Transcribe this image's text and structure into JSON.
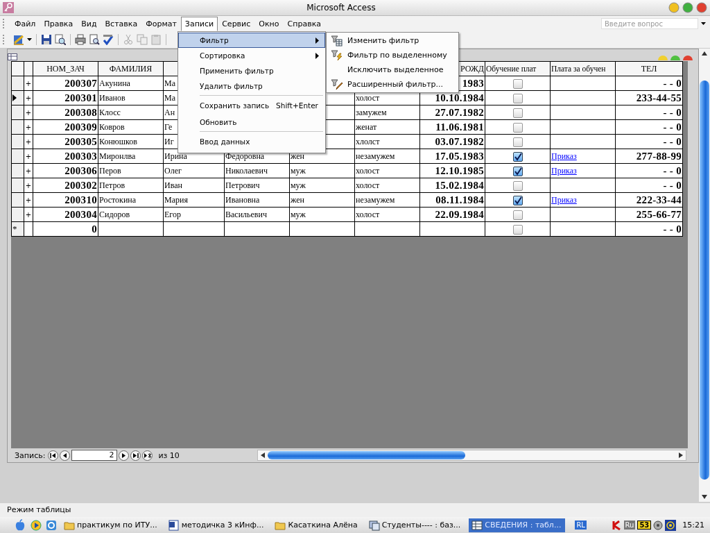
{
  "window": {
    "title": "Microsoft Access"
  },
  "menu_bar": [
    {
      "label": "Файл",
      "selected": false
    },
    {
      "label": "Правка",
      "selected": false
    },
    {
      "label": "Вид",
      "selected": false
    },
    {
      "label": "Вставка",
      "selected": false
    },
    {
      "label": "Формат",
      "selected": false
    },
    {
      "label": "Записи",
      "selected": true
    },
    {
      "label": "Сервис",
      "selected": false
    },
    {
      "label": "Окно",
      "selected": false
    },
    {
      "label": "Справка",
      "selected": false
    }
  ],
  "help_search": {
    "placeholder": "Введите вопрос"
  },
  "menu": [
    {
      "label": "Фильтр",
      "submenu": true,
      "selected": true,
      "separator_before": false
    },
    {
      "label": "Сортировка",
      "submenu": true,
      "selected": false,
      "separator_before": false
    },
    {
      "label": "Применить фильтр",
      "submenu": false,
      "selected": false,
      "separator_before": false
    },
    {
      "label": "Удалить фильтр",
      "submenu": false,
      "selected": false,
      "separator_before": false
    },
    {
      "label": "Сохранить запись",
      "shortcut": "Shift+Enter",
      "submenu": false,
      "selected": false,
      "separator_before": true
    },
    {
      "label": "Обновить",
      "submenu": false,
      "selected": false,
      "separator_before": false
    },
    {
      "label": "Ввод данных",
      "submenu": false,
      "selected": false,
      "separator_before": true
    }
  ],
  "submenu": [
    {
      "label": "Изменить фильтр",
      "kind": "grid"
    },
    {
      "label": "Фильтр по выделенному",
      "kind": "bolt"
    },
    {
      "label": "Исключить выделенное",
      "kind": "plain"
    },
    {
      "label": "Расширенный фильтр...",
      "kind": "pencil"
    }
  ],
  "table": {
    "columns": [
      "НОМ_ЗАЧ",
      "ФАМИЛИЯ",
      null,
      null,
      null,
      null,
      "РОЖД",
      "Обучение плат",
      "Плата за обучен",
      "ТЕЛ"
    ],
    "rows": [
      {
        "current": false,
        "selector": null,
        "expander": "+",
        "cells": [
          "200307",
          "Акунина",
          "Ма",
          null,
          null,
          null,
          "1983"
        ],
        "paid": false,
        "order": null,
        "phone": "- - 0"
      },
      {
        "current": true,
        "selector": null,
        "expander": "+",
        "cells": [
          "200301",
          "Иванов",
          "Ма",
          null,
          null,
          "холост",
          "10.10.1984"
        ],
        "paid": false,
        "order": null,
        "phone": "233-44-55"
      },
      {
        "current": false,
        "selector": null,
        "expander": "+",
        "cells": [
          "200308",
          "Клосс",
          "Ан",
          null,
          null,
          "замужем",
          "27.07.1982"
        ],
        "paid": false,
        "order": null,
        "phone": "- - 0"
      },
      {
        "current": false,
        "selector": null,
        "expander": "+",
        "cells": [
          "200309",
          "Ковров",
          "Ге",
          null,
          null,
          "женат",
          "11.06.1981"
        ],
        "paid": false,
        "order": null,
        "phone": "- - 0"
      },
      {
        "current": false,
        "selector": null,
        "expander": "+",
        "cells": [
          "200305",
          "Конюшков",
          "Иг",
          null,
          null,
          "хлолст",
          "03.07.1982"
        ],
        "paid": false,
        "order": null,
        "phone": "- - 0"
      },
      {
        "current": false,
        "selector": null,
        "expander": "+",
        "cells": [
          "200303",
          "Миронлва",
          "Ирина",
          "Федоровна",
          "жен",
          "незамужем",
          "17.05.1983"
        ],
        "paid": true,
        "order": "Приказ",
        "phone": "277-88-99"
      },
      {
        "current": false,
        "selector": null,
        "expander": "+",
        "cells": [
          "200306",
          "Перов",
          "Олег",
          "Николаевич",
          "муж",
          "холост",
          "12.10.1985"
        ],
        "paid": true,
        "order": "Приказ",
        "phone": "- - 0"
      },
      {
        "current": false,
        "selector": null,
        "expander": "+",
        "cells": [
          "200302",
          "Петров",
          "Иван",
          "Петрович",
          "муж",
          "холост",
          "15.02.1984"
        ],
        "paid": false,
        "order": null,
        "phone": "- - 0"
      },
      {
        "current": false,
        "selector": null,
        "expander": "+",
        "cells": [
          "200310",
          "Ростокина",
          "Мария",
          "Ивановна",
          "жен",
          "незамужем",
          "08.11.1984"
        ],
        "paid": true,
        "order": "Приказ",
        "phone": "222-33-44"
      },
      {
        "current": false,
        "selector": null,
        "expander": "+",
        "cells": [
          "200304",
          "Сидоров",
          "Егор",
          "Васильевич",
          "муж",
          "холост",
          "22.09.1984"
        ],
        "paid": false,
        "order": null,
        "phone": "255-66-77"
      },
      {
        "current": false,
        "selector": "*",
        "expander": null,
        "cells": [
          "0",
          null,
          null,
          null,
          null,
          null,
          null
        ],
        "paid": false,
        "order": null,
        "phone": "- - 0"
      }
    ]
  },
  "record_nav": {
    "label": "Запись:",
    "current": "2",
    "total": "из 10"
  },
  "status_bar": "Режим таблицы",
  "taskbar": {
    "buttons": [
      {
        "label": "практикум по ИТУ...",
        "kind": "folder",
        "selected": false
      },
      {
        "label": "методичка 3 кИнф...",
        "kind": "document",
        "selected": false
      },
      {
        "label": "Касаткина Алёна",
        "kind": "folder",
        "selected": false
      },
      {
        "label": "Студенты---- : баз...",
        "kind": "window",
        "selected": false
      },
      {
        "label": "СВЕДЕНИЯ : табл...",
        "kind": "table",
        "selected": true
      }
    ],
    "language": "RL",
    "tray": [
      "Ru",
      "53"
    ],
    "clock": "15:21"
  }
}
